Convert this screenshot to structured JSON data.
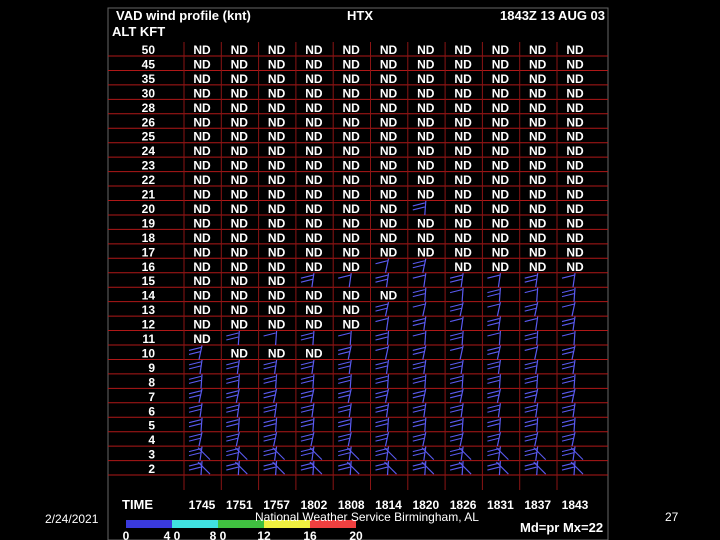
{
  "header": {
    "title": "VAD wind profile (knt)",
    "station": "HTX",
    "datetime": "1843Z 13 AUG 03",
    "alt_label": "ALT KFT"
  },
  "time_label": "TIME",
  "mode_text": "Md=pr Mx=22",
  "colorbar": {
    "labels": [
      "0",
      "4 0",
      "8 0",
      "12",
      "16",
      "20"
    ],
    "colors": [
      "#3a3adc",
      "#40e0e0",
      "#40c040",
      "#f0f040",
      "#f04040"
    ]
  },
  "footer": {
    "date": "2/24/2021",
    "org": "National Weather Service Birmingham, AL",
    "page": "27"
  },
  "chart_data": {
    "type": "table",
    "title": "VAD wind profile (knt)",
    "altitudes_kft": [
      "50",
      "45",
      "35",
      "30",
      "28",
      "26",
      "25",
      "24",
      "23",
      "22",
      "21",
      "20",
      "19",
      "18",
      "17",
      "16",
      "15",
      "14",
      "13",
      "12",
      "11",
      "10",
      "9",
      "8",
      "7",
      "6",
      "5",
      "4",
      "3",
      "2"
    ],
    "times": [
      "1745",
      "1751",
      "1757",
      "1802",
      "1808",
      "1814",
      "1820",
      "1826",
      "1831",
      "1837",
      "1843"
    ],
    "no_data_marker": "ND",
    "no_data": [
      {
        "time": "1745",
        "altitudes": [
          "50",
          "45",
          "35",
          "30",
          "28",
          "26",
          "25",
          "24",
          "23",
          "22",
          "21",
          "20",
          "19",
          "18",
          "17",
          "16",
          "15",
          "14",
          "13",
          "12",
          "11"
        ]
      },
      {
        "time": "1751",
        "altitudes": [
          "50",
          "45",
          "35",
          "30",
          "28",
          "26",
          "25",
          "24",
          "23",
          "22",
          "21",
          "20",
          "19",
          "18",
          "17",
          "16",
          "15",
          "14",
          "13",
          "12",
          "10"
        ]
      },
      {
        "time": "1757",
        "altitudes": [
          "50",
          "45",
          "35",
          "30",
          "28",
          "26",
          "25",
          "24",
          "23",
          "22",
          "21",
          "20",
          "19",
          "18",
          "17",
          "16",
          "15",
          "14",
          "13",
          "12",
          "10"
        ]
      },
      {
        "time": "1802",
        "altitudes": [
          "50",
          "45",
          "35",
          "30",
          "28",
          "26",
          "25",
          "24",
          "23",
          "22",
          "21",
          "20",
          "19",
          "18",
          "17",
          "16",
          "14",
          "13",
          "12",
          "10"
        ]
      },
      {
        "time": "1808",
        "altitudes": [
          "50",
          "45",
          "35",
          "30",
          "28",
          "26",
          "25",
          "24",
          "23",
          "22",
          "21",
          "20",
          "19",
          "18",
          "17",
          "16",
          "14",
          "13",
          "12"
        ]
      },
      {
        "time": "1814",
        "altitudes": [
          "50",
          "45",
          "35",
          "30",
          "28",
          "26",
          "25",
          "24",
          "23",
          "22",
          "21",
          "20",
          "19",
          "18",
          "17",
          "14"
        ]
      },
      {
        "time": "1820",
        "altitudes": [
          "50",
          "45",
          "35",
          "30",
          "28",
          "26",
          "25",
          "24",
          "23",
          "22",
          "21",
          "19",
          "18",
          "17"
        ]
      },
      {
        "time": "1826",
        "altitudes": [
          "50",
          "45",
          "35",
          "30",
          "28",
          "26",
          "25",
          "24",
          "23",
          "22",
          "21",
          "20",
          "19",
          "18",
          "17",
          "16"
        ]
      },
      {
        "time": "1831",
        "altitudes": [
          "50",
          "45",
          "35",
          "30",
          "28",
          "26",
          "25",
          "24",
          "23",
          "22",
          "21",
          "20",
          "19",
          "18",
          "17",
          "16"
        ]
      },
      {
        "time": "1837",
        "altitudes": [
          "50",
          "45",
          "35",
          "30",
          "28",
          "26",
          "25",
          "24",
          "23",
          "22",
          "21",
          "20",
          "19",
          "18",
          "17",
          "16"
        ]
      },
      {
        "time": "1843",
        "altitudes": [
          "50",
          "45",
          "35",
          "30",
          "28",
          "26",
          "25",
          "24",
          "23",
          "22",
          "21",
          "20",
          "19",
          "18",
          "17",
          "16"
        ]
      }
    ],
    "wind_lowest_altitude_kft": "2",
    "grid": true
  }
}
